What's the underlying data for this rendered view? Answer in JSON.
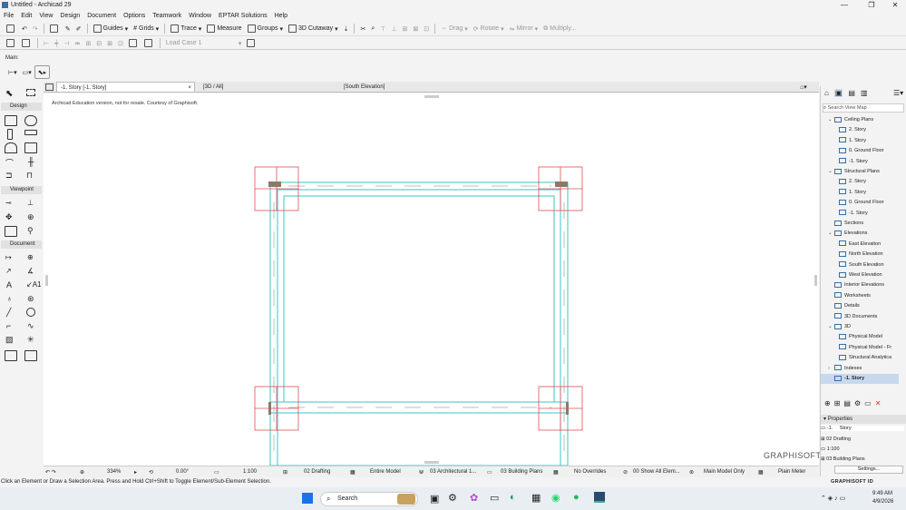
{
  "window": {
    "title": "Untitled - Archicad 29",
    "min": "—",
    "max": "❐",
    "close": "✕"
  },
  "menu": [
    "File",
    "Edit",
    "View",
    "Design",
    "Document",
    "Options",
    "Teamwork",
    "Window",
    "EPTAR Solutions",
    "Help"
  ],
  "toolbar1": {
    "guides": "Guides",
    "grids": "Grids",
    "trace": "Trace",
    "measure": "Measure",
    "groups": "Groups",
    "cutaway": "3D Cutaway",
    "drag": "Drag",
    "rotate": "Rotate",
    "mirror": "Mirror",
    "multiply": "Multiply..."
  },
  "toolbar2": {
    "load_case": "Load Case 1"
  },
  "main_label": "Main:",
  "tabs": {
    "story": "-1. Story [-1. Story]",
    "close": "×",
    "three_d": "[3D / All]",
    "elevation": "[South Elevation]"
  },
  "toolbox": {
    "design": "Design",
    "viewpoint": "Viewpoint",
    "document": "Document"
  },
  "canvas": {
    "note": "Archicad Education version, not for resale. Courtesy of Graphisoft."
  },
  "logo": "GRAPHISOFT.",
  "statusbar": {
    "zoom": "334%",
    "angle": "0.00°",
    "scale": "1:100",
    "layer": "02 Drafting",
    "model": "Entire Model",
    "renovation": "03 Architectural 1...",
    "building": "03 Building Plans",
    "overrides": "No Overrides",
    "show": "00 Show All Elem...",
    "model_only": "Main Model Only",
    "meter": "Plain Meter"
  },
  "hint": "Click an Element or Draw a Selection Area. Press and Hold Ctrl+Shift to Toggle Element/Sub-Element Selection.",
  "viewmap": {
    "search_placeholder": "Search View Map",
    "items": [
      {
        "label": "Ceiling Plans",
        "lvl": 1,
        "arrow": "⌄"
      },
      {
        "label": "2. Story",
        "lvl": 2
      },
      {
        "label": "1. Story",
        "lvl": 2
      },
      {
        "label": "0. Ground Floor",
        "lvl": 2
      },
      {
        "label": "-1. Story",
        "lvl": 2
      },
      {
        "label": "Structural Plans",
        "lvl": 1,
        "arrow": "⌄"
      },
      {
        "label": "2. Story",
        "lvl": 2
      },
      {
        "label": "1. Story",
        "lvl": 2
      },
      {
        "label": "0. Ground Floor",
        "lvl": 2
      },
      {
        "label": "-1. Story",
        "lvl": 2
      },
      {
        "label": "Sections",
        "lvl": 1,
        "arrow": ""
      },
      {
        "label": "Elevations",
        "lvl": 1,
        "arrow": "⌄"
      },
      {
        "label": "East Elevation",
        "lvl": 2
      },
      {
        "label": "North Elevation",
        "lvl": 2
      },
      {
        "label": "South Elevation",
        "lvl": 2
      },
      {
        "label": "West Elevation",
        "lvl": 2
      },
      {
        "label": "Interior Elevations",
        "lvl": 1,
        "arrow": ""
      },
      {
        "label": "Worksheets",
        "lvl": 1,
        "arrow": ""
      },
      {
        "label": "Details",
        "lvl": 1,
        "arrow": ""
      },
      {
        "label": "3D Documents",
        "lvl": 1,
        "arrow": ""
      },
      {
        "label": "3D",
        "lvl": 1,
        "arrow": "⌄"
      },
      {
        "label": "Physical Model",
        "lvl": 2
      },
      {
        "label": "Physical Model - Fr",
        "lvl": 2
      },
      {
        "label": "Structural Analytica",
        "lvl": 2
      },
      {
        "label": "Indexes",
        "lvl": 1,
        "arrow": "›"
      },
      {
        "label": "-1. Story",
        "lvl": 1,
        "arrow": ""
      }
    ]
  },
  "properties": {
    "header": "Properties",
    "id": "-1.",
    "name": "Story",
    "layer": "02 Drafting",
    "scale": "1:100",
    "plans": "03 Building Plans",
    "settings": "Settings...",
    "brand": "GRAPHISOFT ID"
  },
  "taskbar": {
    "search": "Search",
    "time": "9:49 AM",
    "date": "4/9/2026"
  },
  "colors": {
    "wall": "#3cc6c6",
    "column": "#e05050",
    "accent": "#3a6ea5"
  }
}
